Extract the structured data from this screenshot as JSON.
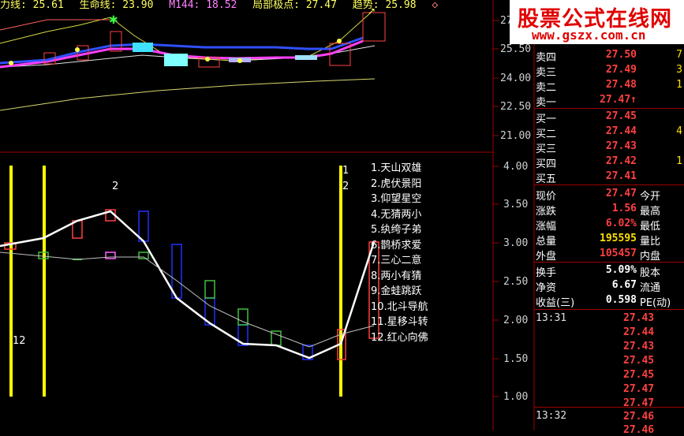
{
  "top_legend": [
    {
      "text": "力线: 25.61",
      "color": "#ffff60"
    },
    {
      "text": "生命线: 23.90",
      "color": "#ffff60"
    },
    {
      "text": "M144: 18.52",
      "color": "#ff80ff"
    },
    {
      "text": "局部极点: 27.47",
      "color": "#ffff60"
    },
    {
      "text": "趋势: 25.98",
      "color": "#ffff60"
    }
  ],
  "top_icon": "diamond-icon",
  "upper_axis": [
    "27",
    "25.50",
    "24.00",
    "22.50",
    "21.00"
  ],
  "lower_axis": [
    "4.00",
    "3.50",
    "3.00",
    "2.50",
    "2.00",
    "1.50",
    "1.00"
  ],
  "signal_list": [
    "1.天山双雄",
    "2.虎伏景阳",
    "3.仰望星空",
    "4.无猜两小",
    "5.纨绔子弟",
    "6.鹊桥求爱",
    "7.三心二意",
    "8.两小有猜",
    "9.金蛙跳跃",
    "10.北斗导航",
    "11.星移斗转",
    "12.红心向佛"
  ],
  "markers": {
    "m12": "12",
    "m2": "2",
    "m1b": "1",
    "m2b": "2"
  },
  "logo": {
    "title": "股票公式在线网",
    "url": "www.gszx.com.cn"
  },
  "order_book": {
    "sell": [
      {
        "label": "卖四",
        "price": "27.50",
        "vol": "7"
      },
      {
        "label": "卖三",
        "price": "27.49",
        "vol": "3"
      },
      {
        "label": "卖二",
        "price": "27.48",
        "vol": "1"
      },
      {
        "label": "卖一",
        "price": "27.47↑",
        "vol": ""
      }
    ],
    "buy": [
      {
        "label": "买一",
        "price": "27.45",
        "vol": ""
      },
      {
        "label": "买二",
        "price": "27.44",
        "vol": "4"
      },
      {
        "label": "买三",
        "price": "27.43",
        "vol": ""
      },
      {
        "label": "买四",
        "price": "27.42",
        "vol": "1"
      },
      {
        "label": "买五",
        "price": "27.41",
        "vol": ""
      }
    ]
  },
  "quote": [
    {
      "label": "现价",
      "value": "27.47",
      "label2": "今开",
      "color": "#ff4040"
    },
    {
      "label": "涨跌",
      "value": "1.56",
      "label2": "最高",
      "color": "#ff4040"
    },
    {
      "label": "涨幅",
      "value": "6.02%",
      "label2": "最低",
      "color": "#ff4040"
    },
    {
      "label": "总量",
      "value": "195595",
      "label2": "量比",
      "color": "#ffe000"
    },
    {
      "label": "外盘",
      "value": "105457",
      "label2": "内盘",
      "color": "#ff4040"
    }
  ],
  "fundamentals": [
    {
      "label": "换手",
      "value": "5.09%",
      "label2": "股本"
    },
    {
      "label": "净资",
      "value": "6.67",
      "label2": "流通"
    },
    {
      "label": "收益(三)",
      "value": "0.598",
      "label2": "PE(动)"
    }
  ],
  "ticks_1331": {
    "time": "13:31",
    "prices": [
      "27.43",
      "27.44",
      "27.43",
      "27.45",
      "27.45",
      "27.47",
      "27.47"
    ]
  },
  "ticks_1332": {
    "time": "13:32",
    "prices": [
      "27.46",
      "27.46"
    ]
  },
  "colors": {
    "up": "#ff4040",
    "down": "#4080ff",
    "signal": "#ffff00"
  }
}
